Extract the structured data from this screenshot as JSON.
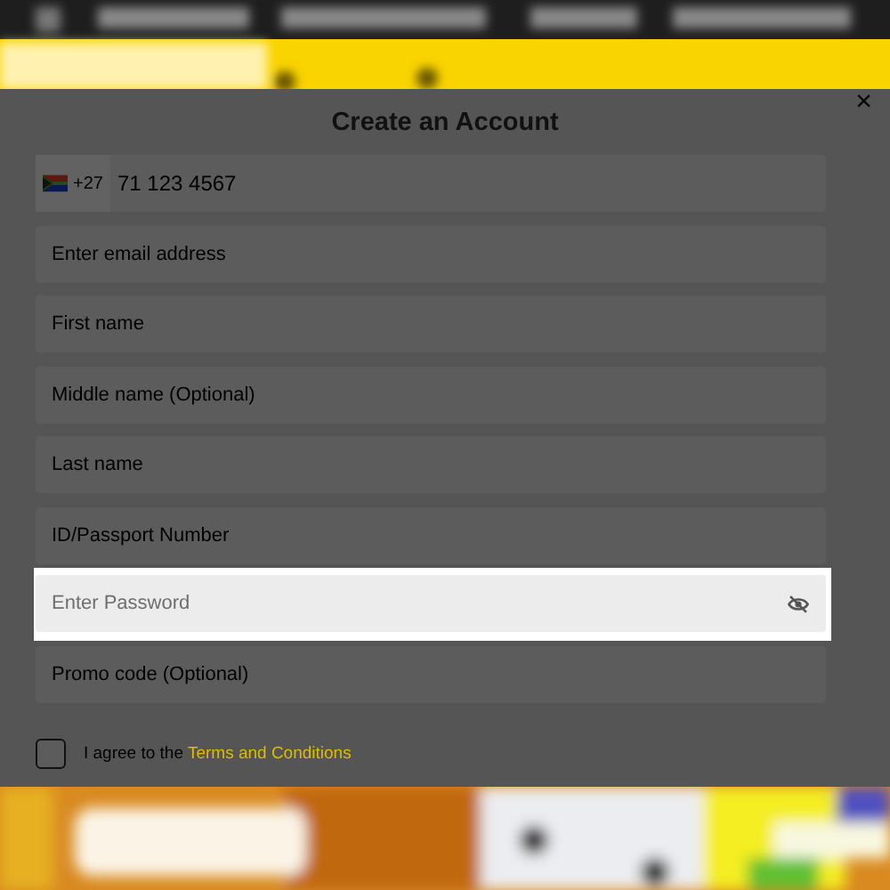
{
  "dialog": {
    "close": "×",
    "title": "Create an Account",
    "phone": {
      "country_code": "+27",
      "value": "71 123 4567"
    },
    "fields": [
      {
        "placeholder": "Enter email address",
        "kind": "text",
        "highlighted": false
      },
      {
        "placeholder": "First name",
        "kind": "text",
        "highlighted": false
      },
      {
        "placeholder": "Middle name (Optional)",
        "kind": "text",
        "highlighted": false
      },
      {
        "placeholder": "Last name",
        "kind": "text",
        "highlighted": false
      },
      {
        "placeholder": "ID/Passport Number",
        "kind": "text",
        "highlighted": false
      },
      {
        "placeholder": "Enter Password",
        "kind": "password",
        "highlighted": true
      },
      {
        "placeholder": "Promo code (Optional)",
        "kind": "text",
        "highlighted": false
      }
    ],
    "agree": {
      "checked": false,
      "text": "I agree to the",
      "link": "Terms and Conditions"
    }
  }
}
